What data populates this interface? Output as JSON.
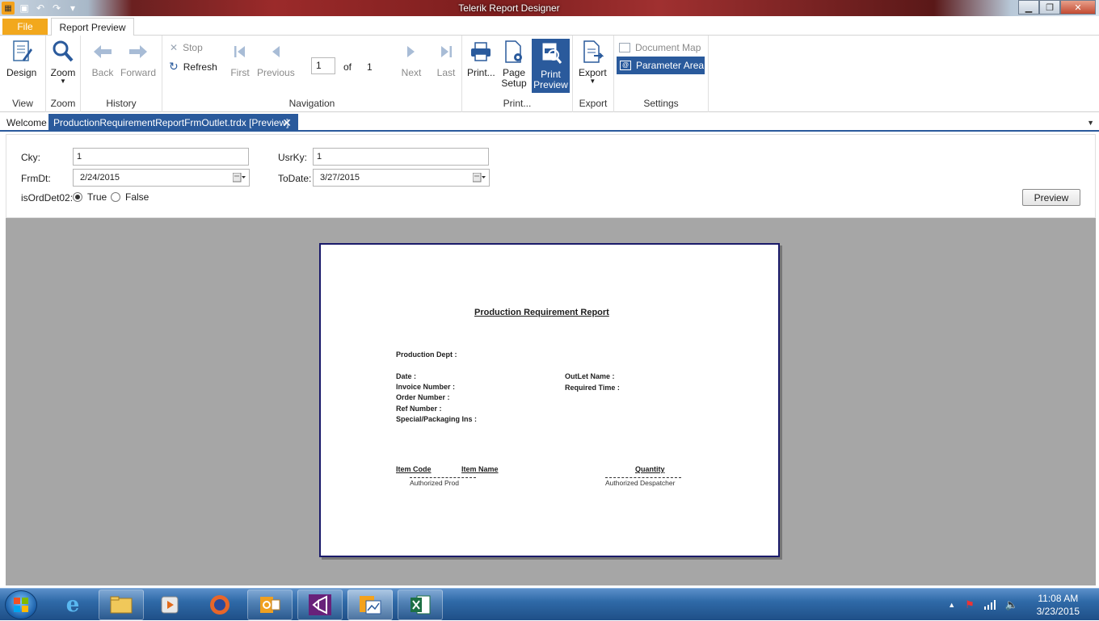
{
  "window": {
    "title": "Telerik Report Designer"
  },
  "ribbon_tabs": {
    "file": "File",
    "report_preview": "Report Preview"
  },
  "ribbon": {
    "view": {
      "design": "Design",
      "label": "View"
    },
    "zoom": {
      "zoom": "Zoom",
      "label": "Zoom"
    },
    "history": {
      "back": "Back",
      "forward": "Forward",
      "label": "History"
    },
    "navigation": {
      "stop": "Stop",
      "refresh": "Refresh",
      "first": "First",
      "previous": "Previous",
      "page": "1",
      "of": "of",
      "total": "1",
      "next": "Next",
      "last": "Last",
      "label": "Navigation"
    },
    "print": {
      "print": "Print...",
      "page_setup_1": "Page",
      "page_setup_2": "Setup",
      "print_preview_1": "Print",
      "print_preview_2": "Preview",
      "label": "Print..."
    },
    "export": {
      "export": "Export",
      "label": "Export"
    },
    "settings": {
      "document_map": "Document Map",
      "parameter_area": "Parameter Area",
      "label": "Settings"
    }
  },
  "doc_tabs": {
    "welcome": "Welcome",
    "active": "ProductionRequirementReportFrmOutlet.trdx [Preview]"
  },
  "params": {
    "cky_label": "Cky:",
    "cky_value": "1",
    "usrky_label": "UsrKy:",
    "usrky_value": "1",
    "frmdt_label": "FrmDt:",
    "frmdt_value": "2/24/2015",
    "todate_label": "ToDate:",
    "todate_value": "3/27/2015",
    "isorddet_label": "isOrdDet02:",
    "true_label": "True",
    "false_label": "False",
    "preview_button": "Preview"
  },
  "report": {
    "title": "Production Requirement Report",
    "production_dept": "Production Dept :",
    "date": "Date :",
    "invoice_number": "Invoice Number :",
    "order_number": "Order Number :",
    "ref_number": "Ref Number :",
    "special": "Special/Packaging Ins :",
    "outlet_name": "OutLet Name :",
    "required_time": "Required Time :",
    "col_item_code": "Item Code",
    "col_item_name": "Item Name",
    "col_quantity": "Quantity",
    "sig_prod": "Authorized Prod",
    "sig_despatcher": "Authorized Despatcher"
  },
  "taskbar": {
    "time": "11:08 AM",
    "date": "3/23/2015"
  }
}
